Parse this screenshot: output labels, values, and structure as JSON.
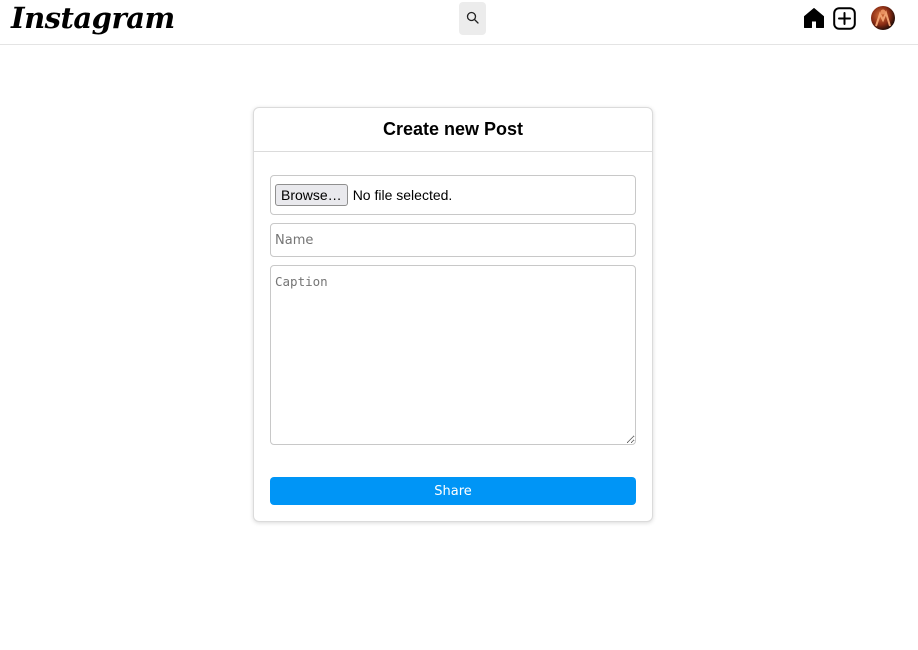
{
  "header": {
    "logo_text": "Instagram",
    "icons": {
      "search": "search-icon",
      "home": "home-icon",
      "create": "add-post-icon",
      "profile": "avatar"
    }
  },
  "create_post": {
    "title": "Create new Post",
    "file_input": {
      "button_label": "Browse…",
      "status": "No file selected."
    },
    "name_field": {
      "placeholder": "Name",
      "value": ""
    },
    "caption_field": {
      "placeholder": "Caption",
      "value": ""
    },
    "share_label": "Share"
  },
  "colors": {
    "accent": "#0095f6",
    "border": "#dbdbdb",
    "search_bg": "#ececec"
  }
}
